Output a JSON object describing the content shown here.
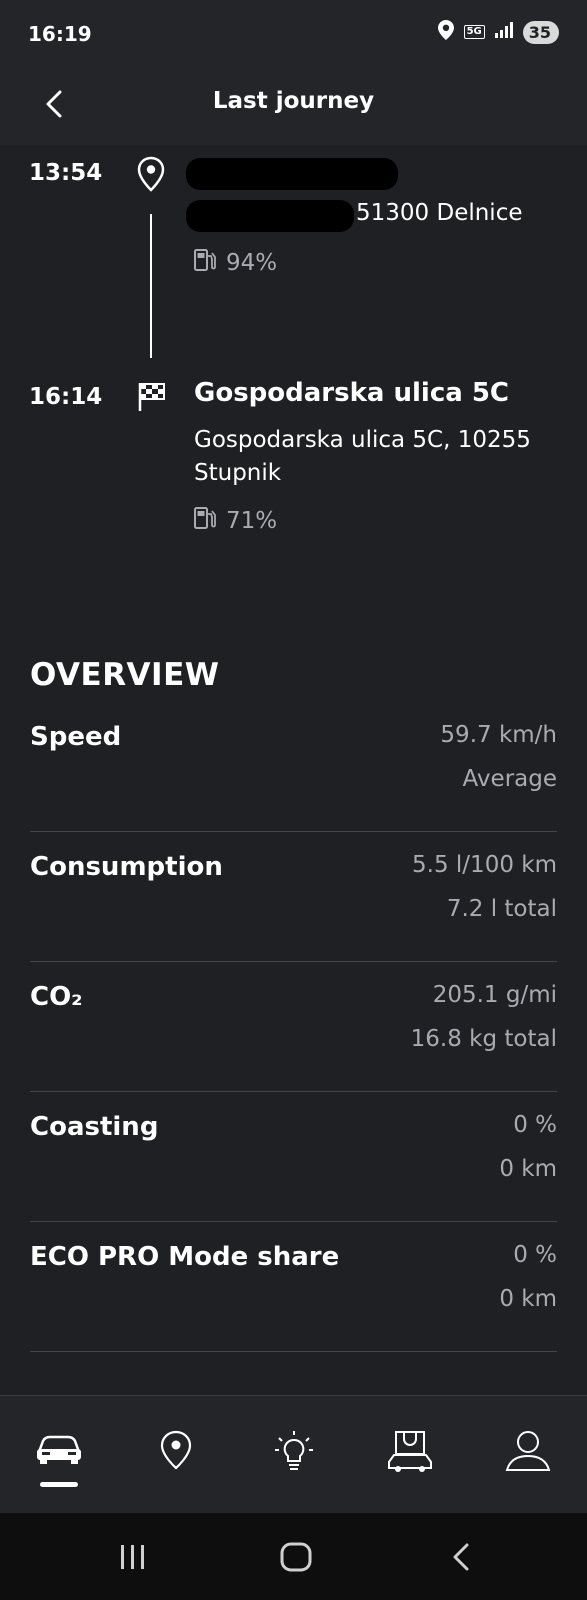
{
  "status_bar": {
    "time": "16:19",
    "network": "5G",
    "battery": "35",
    "icons": [
      "location-icon",
      "signal-icon",
      "battery-icon"
    ]
  },
  "header": {
    "title": "Last journey",
    "back_icon": "chevron-left-icon"
  },
  "journey": {
    "start": {
      "time": "13:54",
      "address_city": "51300 Delnice",
      "fuel": "94%",
      "icon": "location-pin-icon"
    },
    "end": {
      "time": "16:14",
      "title": "Gospodarska ulica 5C",
      "address": "Gospodarska ulica 5C, 10255 Stupnik",
      "fuel": "71%",
      "icon": "checkered-flag-icon"
    }
  },
  "overview": {
    "title": "OVERVIEW",
    "metrics": [
      {
        "label": "Speed",
        "primary": "59.7 km/h",
        "secondary": "Average"
      },
      {
        "label": "Consumption",
        "primary": "5.5 l/100 km",
        "secondary": "7.2 l total"
      },
      {
        "label": "CO₂",
        "primary": "205.1 g/mi",
        "secondary": "16.8 kg total"
      },
      {
        "label": "Coasting",
        "primary": "0 %",
        "secondary": "0 km"
      },
      {
        "label": "ECO PRO Mode share",
        "primary": "0 %",
        "secondary": "0 km"
      }
    ]
  },
  "bottom_nav": {
    "items": [
      "car-icon",
      "map-pin-icon",
      "lightbulb-icon",
      "shop-car-icon",
      "profile-icon"
    ],
    "active_index": 0
  },
  "system_nav": {
    "buttons": [
      "recents-icon",
      "home-icon",
      "back-icon"
    ]
  },
  "colors": {
    "background": "#1f2023",
    "header": "#242529",
    "text_secondary": "#a9abb0",
    "divider": "#44464b"
  }
}
